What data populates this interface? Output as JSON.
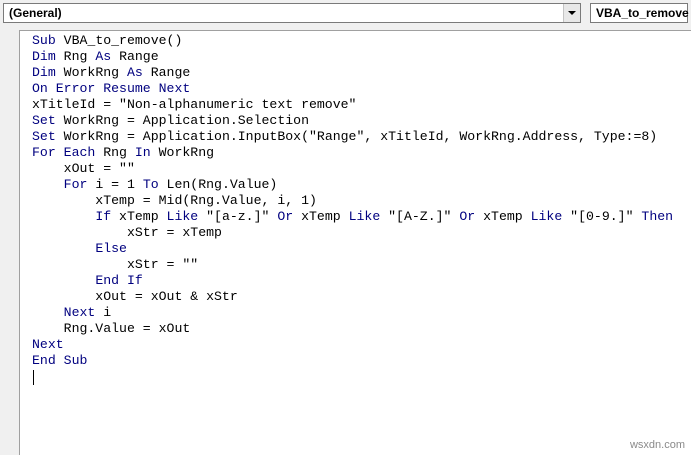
{
  "object_combo": {
    "value": "(General)"
  },
  "procedure_combo": {
    "value": "VBA_to_remove"
  },
  "colors": {
    "keyword": "#00007f",
    "text": "#000000",
    "background": "#ffffff"
  },
  "code_lines": [
    [
      {
        "k": true,
        "t": "Sub"
      },
      {
        "k": false,
        "t": " VBA_to_remove()"
      }
    ],
    [
      {
        "k": true,
        "t": "Dim"
      },
      {
        "k": false,
        "t": " Rng "
      },
      {
        "k": true,
        "t": "As"
      },
      {
        "k": false,
        "t": " Range"
      }
    ],
    [
      {
        "k": true,
        "t": "Dim"
      },
      {
        "k": false,
        "t": " WorkRng "
      },
      {
        "k": true,
        "t": "As"
      },
      {
        "k": false,
        "t": " Range"
      }
    ],
    [
      {
        "k": true,
        "t": "On Error Resume Next"
      }
    ],
    [
      {
        "k": false,
        "t": "xTitleId = \"Non-alphanumeric text remove\""
      }
    ],
    [
      {
        "k": true,
        "t": "Set"
      },
      {
        "k": false,
        "t": " WorkRng = Application.Selection"
      }
    ],
    [
      {
        "k": true,
        "t": "Set"
      },
      {
        "k": false,
        "t": " WorkRng = Application.InputBox(\"Range\", xTitleId, WorkRng.Address, Type:=8)"
      }
    ],
    [
      {
        "k": true,
        "t": "For Each"
      },
      {
        "k": false,
        "t": " Rng "
      },
      {
        "k": true,
        "t": "In"
      },
      {
        "k": false,
        "t": " WorkRng"
      }
    ],
    [
      {
        "k": false,
        "t": "    xOut = \"\""
      }
    ],
    [
      {
        "k": false,
        "t": "    "
      },
      {
        "k": true,
        "t": "For"
      },
      {
        "k": false,
        "t": " i = 1 "
      },
      {
        "k": true,
        "t": "To"
      },
      {
        "k": false,
        "t": " Len(Rng.Value)"
      }
    ],
    [
      {
        "k": false,
        "t": "        xTemp = Mid(Rng.Value, i, 1)"
      }
    ],
    [
      {
        "k": false,
        "t": "        "
      },
      {
        "k": true,
        "t": "If"
      },
      {
        "k": false,
        "t": " xTemp "
      },
      {
        "k": true,
        "t": "Like"
      },
      {
        "k": false,
        "t": " \"[a-z.]\" "
      },
      {
        "k": true,
        "t": "Or"
      },
      {
        "k": false,
        "t": " xTemp "
      },
      {
        "k": true,
        "t": "Like"
      },
      {
        "k": false,
        "t": " \"[A-Z.]\" "
      },
      {
        "k": true,
        "t": "Or"
      },
      {
        "k": false,
        "t": " xTemp "
      },
      {
        "k": true,
        "t": "Like"
      },
      {
        "k": false,
        "t": " \"[0-9.]\" "
      },
      {
        "k": true,
        "t": "Then"
      }
    ],
    [
      {
        "k": false,
        "t": "            xStr = xTemp"
      }
    ],
    [
      {
        "k": false,
        "t": "        "
      },
      {
        "k": true,
        "t": "Else"
      }
    ],
    [
      {
        "k": false,
        "t": "            xStr = \"\""
      }
    ],
    [
      {
        "k": false,
        "t": "        "
      },
      {
        "k": true,
        "t": "End If"
      }
    ],
    [
      {
        "k": false,
        "t": "        xOut = xOut & xStr"
      }
    ],
    [
      {
        "k": false,
        "t": "    "
      },
      {
        "k": true,
        "t": "Next"
      },
      {
        "k": false,
        "t": " i"
      }
    ],
    [
      {
        "k": false,
        "t": "    Rng.Value = xOut"
      }
    ],
    [
      {
        "k": true,
        "t": "Next"
      }
    ],
    [
      {
        "k": true,
        "t": "End Sub"
      }
    ]
  ],
  "watermark": "wsxdn.com"
}
